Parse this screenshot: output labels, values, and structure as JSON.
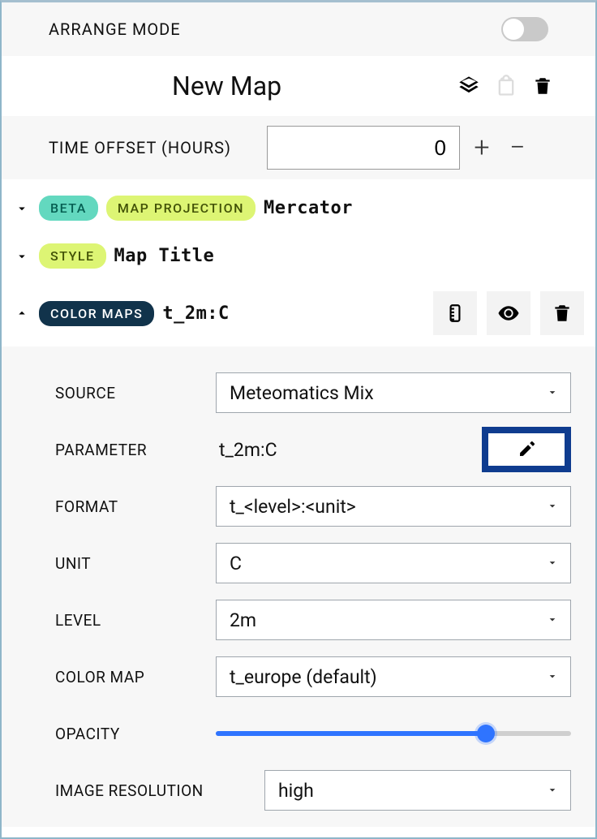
{
  "arrange_mode_label": "ARRANGE MODE",
  "arrange_mode_on": false,
  "map_title": "New Map",
  "time_offset": {
    "label": "TIME OFFSET (HOURS)",
    "value": "0"
  },
  "sections": {
    "projection": {
      "beta_pill": "BETA",
      "label_pill": "MAP PROJECTION",
      "value": "Mercator"
    },
    "style": {
      "label_pill": "STYLE",
      "value": "Map Title"
    },
    "colormaps": {
      "label_pill": "COLOR MAPS",
      "value": "t_2m:C"
    }
  },
  "form": {
    "source": {
      "label": "SOURCE",
      "value": "Meteomatics Mix"
    },
    "parameter": {
      "label": "PARAMETER",
      "value": "t_2m:C"
    },
    "format": {
      "label": "FORMAT",
      "value": "t_<level>:<unit>"
    },
    "unit": {
      "label": "UNIT",
      "value": "C"
    },
    "level": {
      "label": "LEVEL",
      "value": "2m"
    },
    "color_map": {
      "label": "COLOR MAP",
      "value": "t_europe (default)"
    },
    "opacity": {
      "label": "OPACITY",
      "value_pct": 76
    },
    "resolution": {
      "label": "IMAGE RESOLUTION",
      "value": "high"
    }
  }
}
